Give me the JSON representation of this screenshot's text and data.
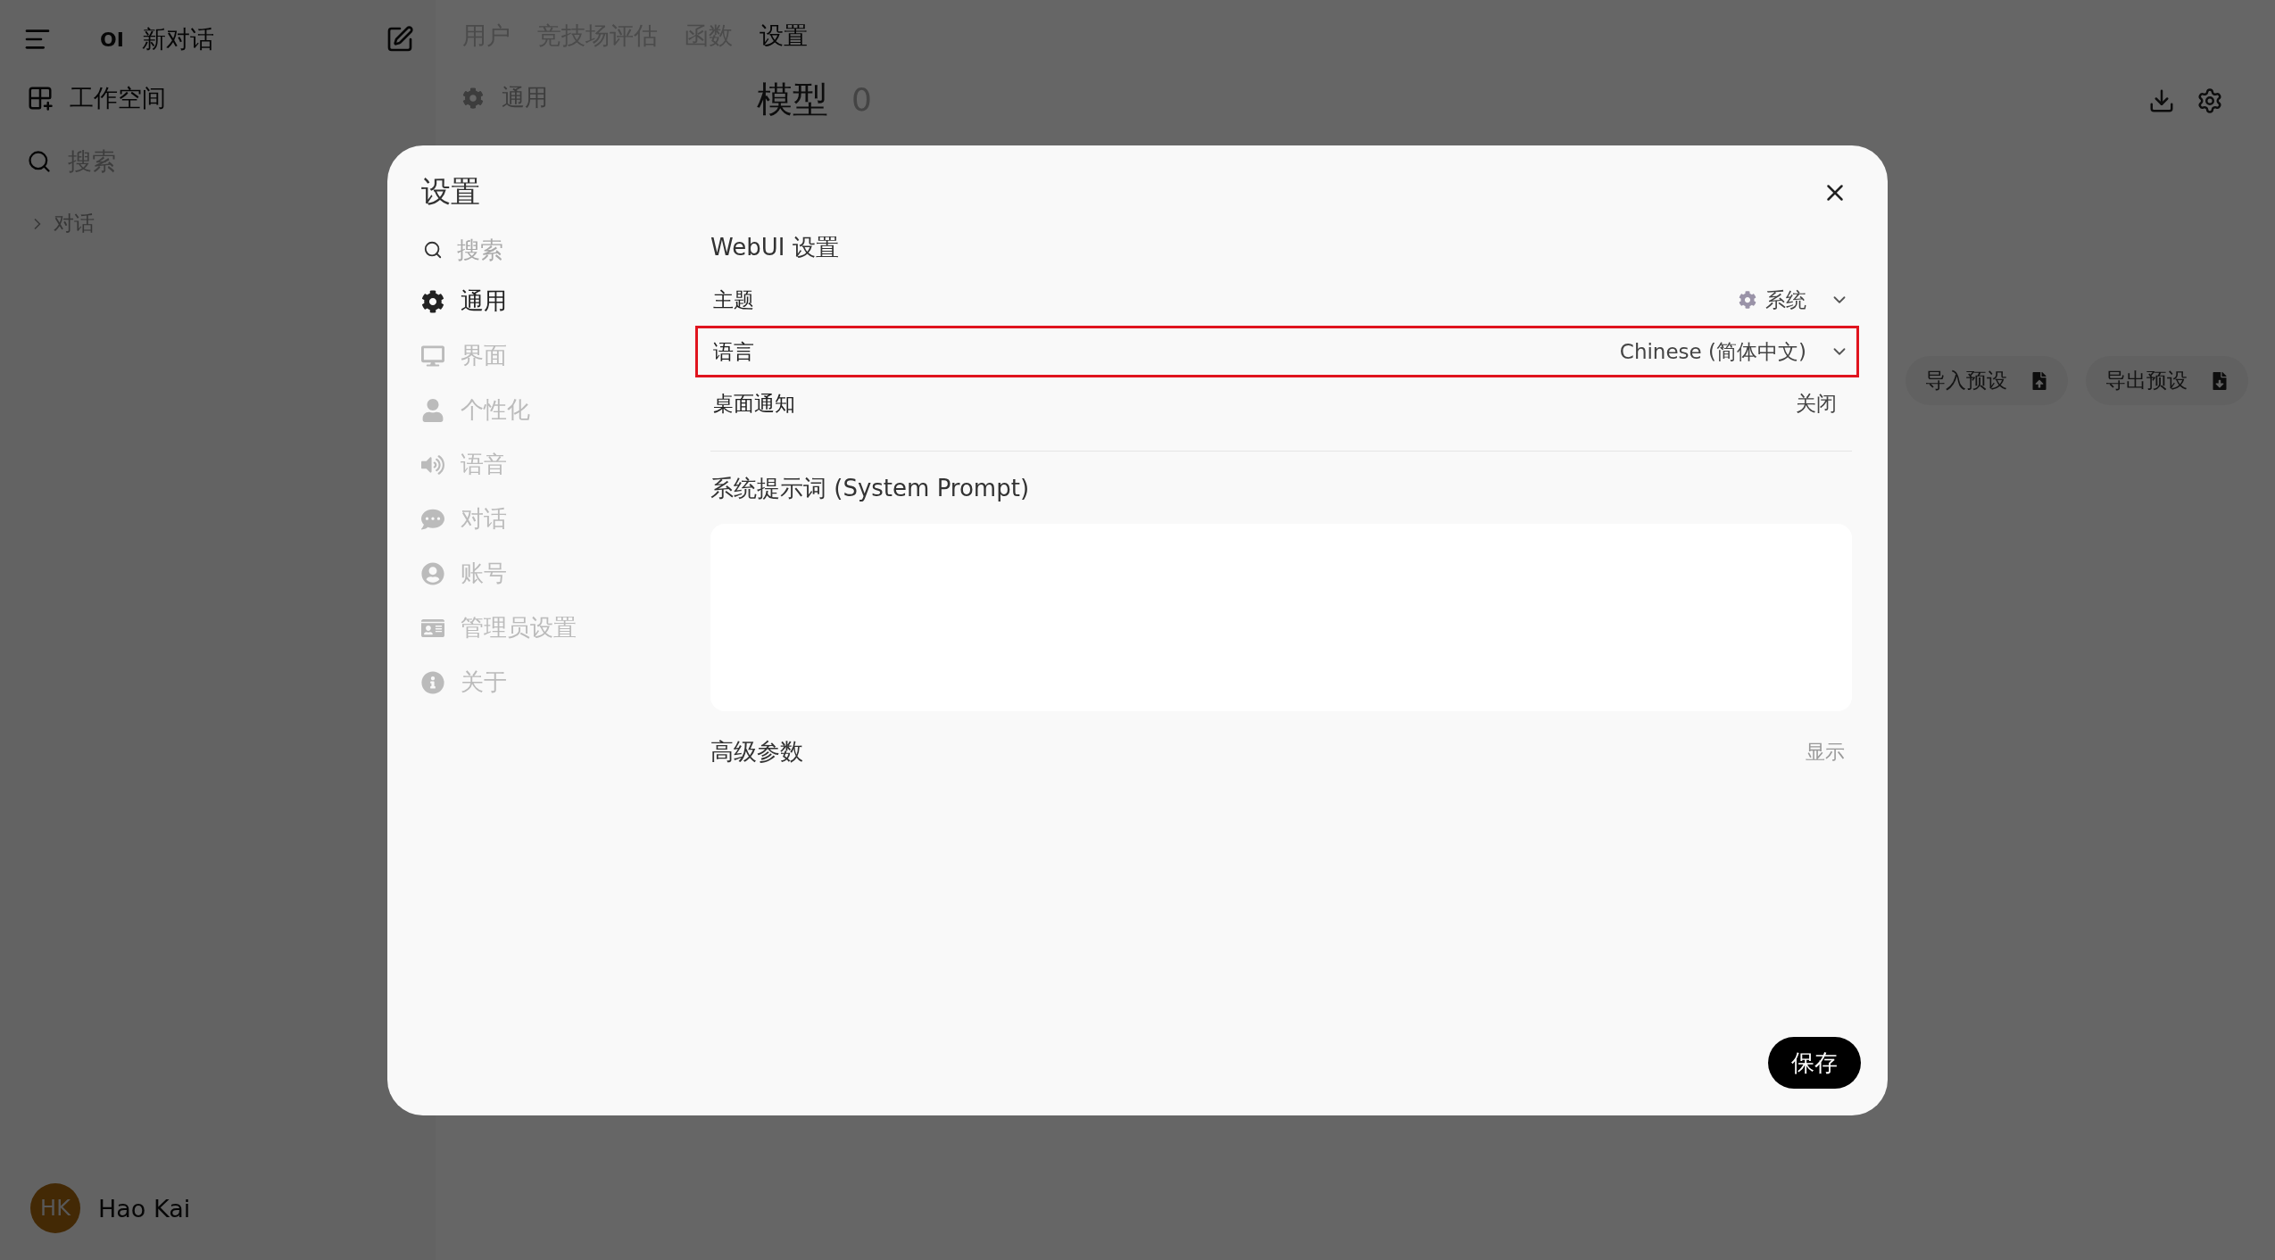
{
  "sidebar": {
    "logo": "OI",
    "title": "新对话",
    "items": [
      {
        "label": "工作空间"
      }
    ],
    "search": {
      "placeholder": "搜索"
    },
    "sections": [
      {
        "label": "对话",
        "expanded": false
      }
    ],
    "user": {
      "initials": "HK",
      "name": "Hao Kai"
    }
  },
  "tabs": [
    {
      "label": "用户",
      "selected": false
    },
    {
      "label": "竞技场评估",
      "selected": false
    },
    {
      "label": "函数",
      "selected": false
    },
    {
      "label": "设置",
      "selected": true
    }
  ],
  "settings_menu": [
    {
      "label": "通用",
      "selected": true
    }
  ],
  "heading": {
    "title": "模型",
    "count": "0"
  },
  "preset_buttons": [
    "导入预设",
    "导出预设"
  ],
  "modal": {
    "title": "设置",
    "search": {
      "placeholder": "搜索"
    },
    "nav": [
      {
        "label": "通用",
        "selected": true
      },
      {
        "label": "界面",
        "selected": false
      },
      {
        "label": "个性化",
        "selected": false
      },
      {
        "label": "语音",
        "selected": false
      },
      {
        "label": "对话",
        "selected": false
      },
      {
        "label": "账号",
        "selected": false
      },
      {
        "label": "管理员设置",
        "selected": false
      },
      {
        "label": "关于",
        "selected": false
      }
    ],
    "section_title": "WebUI 设置",
    "settings": [
      {
        "kind": "select",
        "label": "主题",
        "value": "系统",
        "highlighted": false,
        "has_icon": true
      },
      {
        "kind": "select",
        "label": "语言",
        "value": "Chinese (简体中文)",
        "highlighted": true,
        "has_icon": false
      },
      {
        "kind": "toggle",
        "label": "桌面通知",
        "value": "关闭",
        "highlighted": false,
        "has_icon": false
      }
    ],
    "system_prompt": {
      "label": "系统提示词 (System Prompt)"
    },
    "advanced": {
      "label": "高级参数",
      "action": "显示"
    },
    "save": "保存"
  }
}
